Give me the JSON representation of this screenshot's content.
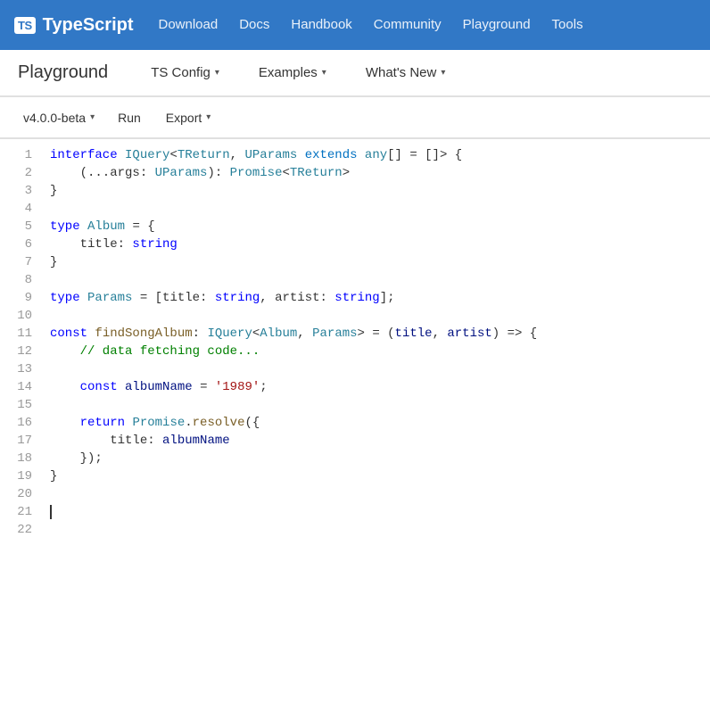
{
  "topnav": {
    "logo_badge": "TS",
    "logo_text": "TypeScript",
    "links": [
      {
        "label": "Download",
        "id": "download"
      },
      {
        "label": "Docs",
        "id": "docs"
      },
      {
        "label": "Handbook",
        "id": "handbook"
      },
      {
        "label": "Community",
        "id": "community"
      },
      {
        "label": "Playground",
        "id": "playground"
      },
      {
        "label": "Tools",
        "id": "tools"
      }
    ]
  },
  "secondarynav": {
    "title": "Playground",
    "items": [
      {
        "label": "TS Config",
        "id": "tsconfig"
      },
      {
        "label": "Examples",
        "id": "examples"
      },
      {
        "label": "What's New",
        "id": "whatsnew"
      }
    ]
  },
  "toolbar": {
    "version": "v4.0.0-beta",
    "run": "Run",
    "export": "Export"
  },
  "code": {
    "lines": [
      {
        "num": 1,
        "content": "interface IQuery<TReturn, UParams extends any[] = []> {"
      },
      {
        "num": 2,
        "content": "    (...args: UParams): Promise<TReturn>"
      },
      {
        "num": 3,
        "content": "}"
      },
      {
        "num": 4,
        "content": ""
      },
      {
        "num": 5,
        "content": "type Album = {"
      },
      {
        "num": 6,
        "content": "    title: string"
      },
      {
        "num": 7,
        "content": "}"
      },
      {
        "num": 8,
        "content": ""
      },
      {
        "num": 9,
        "content": "type Params = [title: string, artist: string];"
      },
      {
        "num": 10,
        "content": ""
      },
      {
        "num": 11,
        "content": "const findSongAlbum: IQuery<Album, Params> = (title, artist) => {"
      },
      {
        "num": 12,
        "content": "    // data fetching code..."
      },
      {
        "num": 13,
        "content": ""
      },
      {
        "num": 14,
        "content": "    const albumName = '1989';"
      },
      {
        "num": 15,
        "content": ""
      },
      {
        "num": 16,
        "content": "    return Promise.resolve({"
      },
      {
        "num": 17,
        "content": "        title: albumName"
      },
      {
        "num": 18,
        "content": "    });"
      },
      {
        "num": 19,
        "content": "}"
      },
      {
        "num": 20,
        "content": ""
      },
      {
        "num": 21,
        "content": ""
      },
      {
        "num": 22,
        "content": ""
      }
    ]
  }
}
